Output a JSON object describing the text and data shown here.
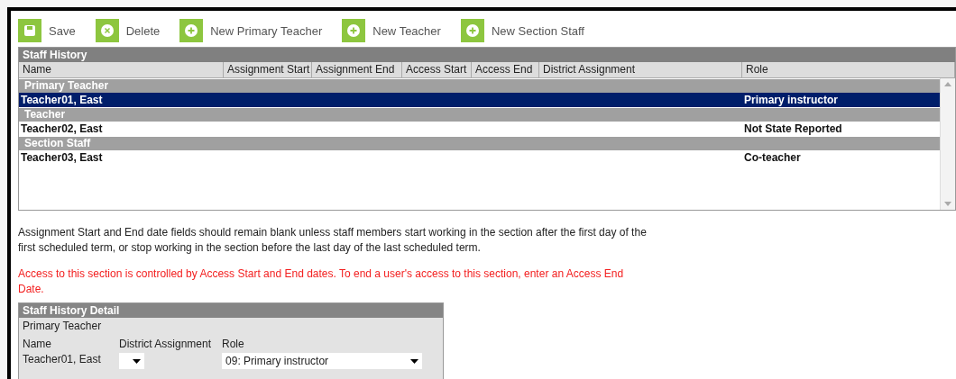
{
  "toolbar": [
    {
      "label": "Save",
      "kind": "save"
    },
    {
      "label": "Delete",
      "kind": "delete"
    },
    {
      "label": "New Primary Teacher",
      "kind": "add"
    },
    {
      "label": "New Teacher",
      "kind": "add"
    },
    {
      "label": "New Section Staff",
      "kind": "add"
    }
  ],
  "staff_history": {
    "title": "Staff History",
    "columns": [
      "Name",
      "Assignment Start",
      "Assignment End",
      "Access Start",
      "Access End",
      "District Assignment",
      "Role"
    ],
    "rows": [
      {
        "kind": "group",
        "label": "Primary Teacher"
      },
      {
        "kind": "staff",
        "name": "Teacher01, East",
        "role": "Primary instructor",
        "selected": true
      },
      {
        "kind": "group",
        "label": "Teacher"
      },
      {
        "kind": "staff",
        "name": "Teacher02, East",
        "role": "Not State Reported",
        "selected": false
      },
      {
        "kind": "group",
        "label": "Section Staff"
      },
      {
        "kind": "staff",
        "name": "Teacher03, East",
        "role": "Co-teacher",
        "selected": false
      }
    ]
  },
  "note": "Assignment Start and End date fields should remain blank unless staff members start working in the section after the first day of the first scheduled term, or stop working in the section before the last day of the last scheduled term.",
  "warning": "Access to this section is controlled by Access Start and End dates. To end a user's access to this section, enter an Access End Date.",
  "detail": {
    "title": "Staff History Detail",
    "type": "Primary Teacher",
    "name_label": "Name",
    "name_value": "Teacher01, East",
    "district_label": "District Assignment",
    "role_label": "Role",
    "role_value": "09: Primary instructor"
  }
}
